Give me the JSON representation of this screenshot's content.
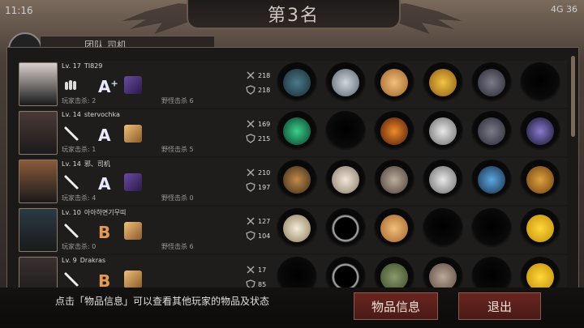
{
  "status_bar": {
    "time": "11:16",
    "network": "4G",
    "battery": "36"
  },
  "header": {
    "title": "第3名",
    "team_label": "团队 司机"
  },
  "players": [
    {
      "level": "Lv. 17",
      "name": "TI829",
      "grade": "A",
      "grade_plus": "+",
      "kills_players": "玩家击杀: 2",
      "kills_monsters": "野怪击杀 6",
      "attack": "218",
      "defense": "218",
      "slots": [
        "dark-weapon",
        "helmet",
        "ice-cream-cone",
        "shield-emblem",
        "gauntlet",
        "empty"
      ]
    },
    {
      "level": "Lv. 14",
      "name": "stervochka",
      "grade": "A",
      "grade_plus": "",
      "kills_players": "玩家击杀: 1",
      "kills_monsters": "野怪击杀 5",
      "attack": "169",
      "defense": "215",
      "slots": [
        "green-wreath",
        "empty",
        "fire-orb",
        "silver-disc",
        "gauntlet",
        "galaxy-orb"
      ]
    },
    {
      "level": "Lv. 14",
      "name": "邪、司机",
      "grade": "A",
      "grade_plus": "",
      "kills_players": "玩家击杀: 4",
      "kills_monsters": "野怪击杀 0",
      "attack": "210",
      "defense": "197",
      "slots": [
        "wooden-staff",
        "mask",
        "armor",
        "silver-disc",
        "blue-gauntlet",
        "treasure-box"
      ]
    },
    {
      "level": "Lv. 10",
      "name": "아아하면기무띠",
      "grade": "B",
      "grade_plus": "",
      "kills_players": "玩家击杀: 0",
      "kills_monsters": "野怪击杀 6",
      "attack": "127",
      "defense": "104",
      "slots": [
        "mushroom-staff",
        "ring",
        "ice-cream-cone",
        "empty",
        "empty",
        "yellow-flower"
      ]
    },
    {
      "level": "Lv. 9",
      "name": "Drakras",
      "grade": "B",
      "grade_plus": "",
      "kills_players": "",
      "kills_monsters": "",
      "attack": "17",
      "defense": "85",
      "slots": [
        "empty",
        "ring",
        "camo-armor",
        "boots",
        "empty",
        "yellow-flower"
      ]
    }
  ],
  "footer": {
    "hint": "点击「物品信息」可以查看其他玩家的物品及状态",
    "item_info_button": "物品信息",
    "exit_button": "退出"
  },
  "colors": {
    "accent_red": "#6a2620",
    "gold": "#e9b93a",
    "panel_border": "#6b5b4e"
  }
}
